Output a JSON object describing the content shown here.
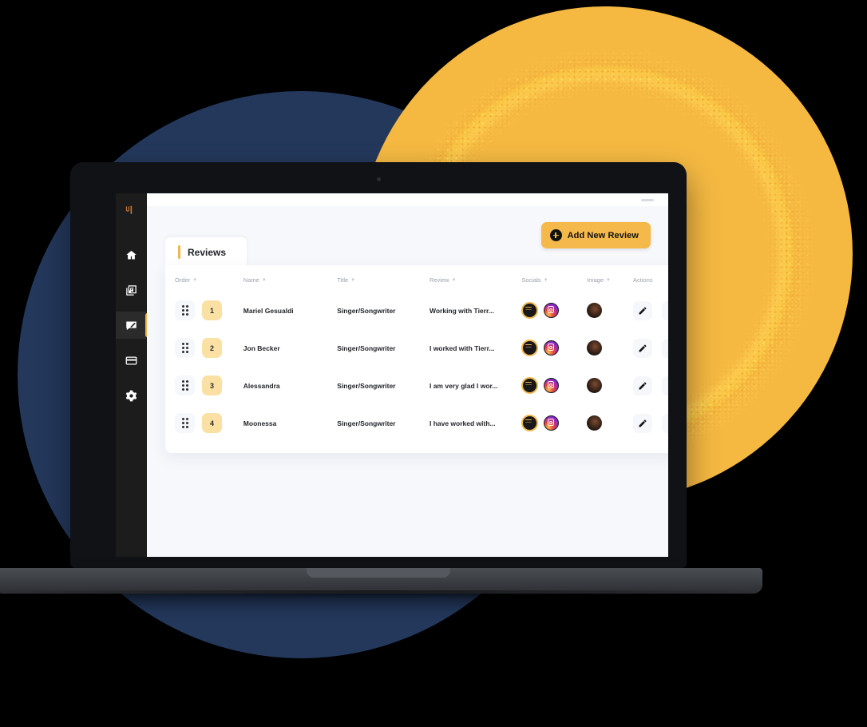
{
  "brand": {
    "logo_name": "app-logo-mark"
  },
  "sidebar": {
    "items": [
      {
        "id": "home",
        "icon": "home-icon",
        "active": false
      },
      {
        "id": "music",
        "icon": "music-library-icon",
        "active": false
      },
      {
        "id": "reviews",
        "icon": "review-message-icon",
        "active": true
      },
      {
        "id": "billing",
        "icon": "credit-card-icon",
        "active": false
      },
      {
        "id": "settings",
        "icon": "gear-icon",
        "active": false
      }
    ]
  },
  "toolbar": {
    "add_label": "Add New Review",
    "add_icon": "plus-circle-icon"
  },
  "tabs": [
    {
      "label": "Reviews",
      "active": true
    }
  ],
  "table": {
    "columns": [
      {
        "key": "order",
        "label": "Order",
        "sortable": true
      },
      {
        "key": "name",
        "label": "Name",
        "sortable": true
      },
      {
        "key": "title",
        "label": "Title",
        "sortable": true
      },
      {
        "key": "review",
        "label": "Review",
        "sortable": true
      },
      {
        "key": "socials",
        "label": "Socials",
        "sortable": true
      },
      {
        "key": "image",
        "label": "Image",
        "sortable": true
      },
      {
        "key": "actions",
        "label": "Actions",
        "sortable": false
      }
    ],
    "sort_arrow": "▼",
    "rows": [
      {
        "order": "1",
        "name": "Mariel Gesualdi",
        "title": "Singer/Songwriter",
        "review": "Working with Tierr...",
        "socials": [
          "spotify-icon",
          "instagram-icon"
        ],
        "image": "avatar-thumbnail",
        "actions": [
          "edit-icon",
          "delete-icon"
        ]
      },
      {
        "order": "2",
        "name": "Jon Becker",
        "title": "Singer/Songwriter",
        "review": "I worked with Tierr...",
        "socials": [
          "spotify-icon",
          "instagram-icon"
        ],
        "image": "avatar-thumbnail",
        "actions": [
          "edit-icon",
          "delete-icon"
        ]
      },
      {
        "order": "3",
        "name": "Alessandra",
        "title": "Singer/Songwriter",
        "review": "I am very glad I wor...",
        "socials": [
          "spotify-icon",
          "instagram-icon"
        ],
        "image": "avatar-thumbnail",
        "actions": [
          "edit-icon",
          "delete-icon"
        ]
      },
      {
        "order": "4",
        "name": "Moonessa",
        "title": "Singer/Songwriter",
        "review": "I have worked with...",
        "socials": [
          "spotify-icon",
          "instagram-icon"
        ],
        "image": "avatar-thumbnail",
        "actions": [
          "edit-icon",
          "delete-icon"
        ]
      }
    ]
  },
  "theme": {
    "accent": "#f5b94b",
    "navy_circle": "#24385c",
    "yellow_circle": "#f5b942",
    "sidebar_bg": "#1c1c1c",
    "app_bg": "#f7f8fc",
    "order_badge_bg": "#fbe0a4"
  }
}
